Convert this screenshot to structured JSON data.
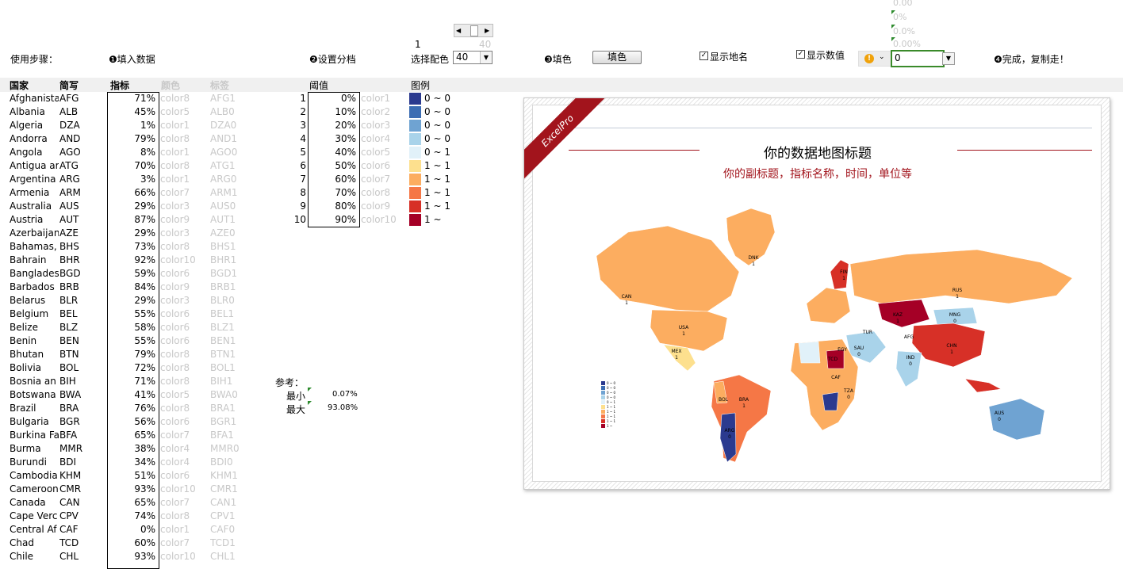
{
  "top": {
    "steps_label": "使用步骤：",
    "step1": "❶填入数据",
    "step2": "❷设置分档",
    "step3": "❸填色",
    "step4": "❹完成，复制走！",
    "scroll_value": "1",
    "scroll_max": "40",
    "select_color_label": "选择配色",
    "select_color_value": "40",
    "fill_button": "填色",
    "show_names_label": "显示地名",
    "show_values_label": "显示数值",
    "format_input_value": "0",
    "format_options": [
      "0.00",
      "0%",
      "0.0%",
      "0.00%"
    ]
  },
  "headers": {
    "country": "国家",
    "code": "简写",
    "indicator": "指标",
    "color": "颜色",
    "label": "标签",
    "threshold": "阈值",
    "legend": "图例"
  },
  "countries": [
    {
      "name": "Afghanista",
      "code": "AFG",
      "pct": "71%",
      "color": "color8",
      "label": "AFG1"
    },
    {
      "name": "Albania",
      "code": "ALB",
      "pct": "45%",
      "color": "color5",
      "label": "ALB0"
    },
    {
      "name": "Algeria",
      "code": "DZA",
      "pct": "1%",
      "color": "color1",
      "label": "DZA0"
    },
    {
      "name": "Andorra",
      "code": "AND",
      "pct": "79%",
      "color": "color8",
      "label": "AND1"
    },
    {
      "name": "Angola",
      "code": "AGO",
      "pct": "8%",
      "color": "color1",
      "label": "AGO0"
    },
    {
      "name": "Antigua ar",
      "code": "ATG",
      "pct": "70%",
      "color": "color8",
      "label": "ATG1"
    },
    {
      "name": "Argentina",
      "code": "ARG",
      "pct": "3%",
      "color": "color1",
      "label": "ARG0"
    },
    {
      "name": "Armenia",
      "code": "ARM",
      "pct": "66%",
      "color": "color7",
      "label": "ARM1"
    },
    {
      "name": "Australia",
      "code": "AUS",
      "pct": "29%",
      "color": "color3",
      "label": "AUS0"
    },
    {
      "name": "Austria",
      "code": "AUT",
      "pct": "87%",
      "color": "color9",
      "label": "AUT1"
    },
    {
      "name": "Azerbaijan",
      "code": "AZE",
      "pct": "29%",
      "color": "color3",
      "label": "AZE0"
    },
    {
      "name": "Bahamas,",
      "code": "BHS",
      "pct": "73%",
      "color": "color8",
      "label": "BHS1"
    },
    {
      "name": "Bahrain",
      "code": "BHR",
      "pct": "92%",
      "color": "color10",
      "label": "BHR1"
    },
    {
      "name": "Banglades",
      "code": "BGD",
      "pct": "59%",
      "color": "color6",
      "label": "BGD1"
    },
    {
      "name": "Barbados",
      "code": "BRB",
      "pct": "84%",
      "color": "color9",
      "label": "BRB1"
    },
    {
      "name": "Belarus",
      "code": "BLR",
      "pct": "29%",
      "color": "color3",
      "label": "BLR0"
    },
    {
      "name": "Belgium",
      "code": "BEL",
      "pct": "55%",
      "color": "color6",
      "label": "BEL1"
    },
    {
      "name": "Belize",
      "code": "BLZ",
      "pct": "58%",
      "color": "color6",
      "label": "BLZ1"
    },
    {
      "name": "Benin",
      "code": "BEN",
      "pct": "55%",
      "color": "color6",
      "label": "BEN1"
    },
    {
      "name": "Bhutan",
      "code": "BTN",
      "pct": "79%",
      "color": "color8",
      "label": "BTN1"
    },
    {
      "name": "Bolivia",
      "code": "BOL",
      "pct": "72%",
      "color": "color8",
      "label": "BOL1"
    },
    {
      "name": "Bosnia an",
      "code": "BIH",
      "pct": "71%",
      "color": "color8",
      "label": "BIH1"
    },
    {
      "name": "Botswana",
      "code": "BWA",
      "pct": "41%",
      "color": "color5",
      "label": "BWA0"
    },
    {
      "name": "Brazil",
      "code": "BRA",
      "pct": "76%",
      "color": "color8",
      "label": "BRA1"
    },
    {
      "name": "Bulgaria",
      "code": "BGR",
      "pct": "56%",
      "color": "color6",
      "label": "BGR1"
    },
    {
      "name": "Burkina Fa",
      "code": "BFA",
      "pct": "65%",
      "color": "color7",
      "label": "BFA1"
    },
    {
      "name": "Burma",
      "code": "MMR",
      "pct": "38%",
      "color": "color4",
      "label": "MMR0"
    },
    {
      "name": "Burundi",
      "code": "BDI",
      "pct": "34%",
      "color": "color4",
      "label": "BDI0"
    },
    {
      "name": "Cambodia",
      "code": "KHM",
      "pct": "51%",
      "color": "color6",
      "label": "KHM1"
    },
    {
      "name": "Cameroon",
      "code": "CMR",
      "pct": "93%",
      "color": "color10",
      "label": "CMR1"
    },
    {
      "name": "Canada",
      "code": "CAN",
      "pct": "65%",
      "color": "color7",
      "label": "CAN1"
    },
    {
      "name": "Cape Verc",
      "code": "CPV",
      "pct": "74%",
      "color": "color8",
      "label": "CPV1"
    },
    {
      "name": "Central Af",
      "code": "CAF",
      "pct": "0%",
      "color": "color1",
      "label": "CAF0"
    },
    {
      "name": "Chad",
      "code": "TCD",
      "pct": "60%",
      "color": "color7",
      "label": "TCD1"
    },
    {
      "name": "Chile",
      "code": "CHL",
      "pct": "93%",
      "color": "color10",
      "label": "CHL1"
    }
  ],
  "thresholds": [
    {
      "n": "1",
      "pct": "0%",
      "color": "color1",
      "legend": "0 ~ 0",
      "swatch": "#2b3a8f"
    },
    {
      "n": "2",
      "pct": "10%",
      "color": "color2",
      "legend": "0 ~ 0",
      "swatch": "#3c6db3"
    },
    {
      "n": "3",
      "pct": "20%",
      "color": "color3",
      "legend": "0 ~ 0",
      "swatch": "#6fa3d2"
    },
    {
      "n": "4",
      "pct": "30%",
      "color": "color4",
      "legend": "0 ~ 0",
      "swatch": "#a9d3ea"
    },
    {
      "n": "5",
      "pct": "40%",
      "color": "color5",
      "legend": "0 ~ 1",
      "swatch": "#e1f1f9"
    },
    {
      "n": "6",
      "pct": "50%",
      "color": "color6",
      "legend": "1 ~ 1",
      "swatch": "#fde08e"
    },
    {
      "n": "7",
      "pct": "60%",
      "color": "color7",
      "legend": "1 ~ 1",
      "swatch": "#fcad60"
    },
    {
      "n": "8",
      "pct": "70%",
      "color": "color8",
      "legend": "1 ~ 1",
      "swatch": "#f57746"
    },
    {
      "n": "9",
      "pct": "80%",
      "color": "color9",
      "legend": "1 ~ 1",
      "swatch": "#d73027"
    },
    {
      "n": "10",
      "pct": "90%",
      "color": "color10",
      "legend": "1 ~",
      "swatch": "#a50026"
    }
  ],
  "reference": {
    "label": "参考：",
    "min_label": "最小",
    "min_value": "0.07%",
    "max_label": "最大",
    "max_value": "93.08%"
  },
  "map": {
    "ribbon": "ExcelPro",
    "title": "你的数据地图标题",
    "subtitle": "你的副标题，指标名称，时间，单位等",
    "labels": [
      {
        "t": "DNK"
      },
      {
        "t": "1"
      },
      {
        "t": "CAN"
      },
      {
        "t": "1"
      },
      {
        "t": "RUS"
      },
      {
        "t": "1"
      },
      {
        "t": "USA"
      },
      {
        "t": "1"
      },
      {
        "t": "MEX"
      },
      {
        "t": "1"
      },
      {
        "t": "CHN"
      },
      {
        "t": "1"
      },
      {
        "t": "MNG"
      },
      {
        "t": "0"
      },
      {
        "t": "KAZ"
      },
      {
        "t": "1"
      },
      {
        "t": "AUS"
      },
      {
        "t": "0"
      },
      {
        "t": "BOL"
      },
      {
        "t": "BRA"
      },
      {
        "t": "1"
      },
      {
        "t": "ARG"
      },
      {
        "t": "0"
      },
      {
        "t": "SAU"
      },
      {
        "t": "0"
      },
      {
        "t": "EGY"
      },
      {
        "t": "TUR"
      },
      {
        "t": "AFG"
      },
      {
        "t": "IND"
      },
      {
        "t": "0"
      },
      {
        "t": "TCD"
      },
      {
        "t": "CAF"
      },
      {
        "t": "TZA"
      },
      {
        "t": "0"
      },
      {
        "t": "FIN"
      },
      {
        "t": "1"
      }
    ],
    "legend_items": [
      "0 ~ 0",
      "0 ~ 0",
      "0 ~ 0",
      "0 ~ 0",
      "0 ~ 1",
      "1 ~ 1",
      "1 ~ 1",
      "1 ~ 1",
      "1 ~ 1",
      "1 ~"
    ]
  },
  "colors": {
    "accent_red": "#a2141c",
    "subtitle_red": "#a2141c",
    "green_border": "#3a8a2a"
  }
}
